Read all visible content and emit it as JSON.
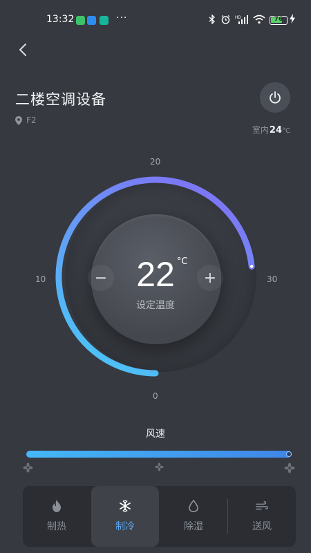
{
  "status": {
    "time": "13:32",
    "dots": "···",
    "battery": "76",
    "battery_level": 0.76
  },
  "header": {
    "title": "二楼空调设备",
    "location": "F2",
    "indoor_label": "室内",
    "indoor_value": "24",
    "indoor_unit": "°C"
  },
  "dial": {
    "tick_top": "20",
    "tick_left": "10",
    "tick_right": "30",
    "tick_bottom": "0",
    "temperature": "22",
    "unit": "°C",
    "label": "设定温度",
    "minus": "−",
    "plus": "+",
    "min": 0,
    "max": 30,
    "arc_colors": [
      "#45cdf7",
      "#7c78f5"
    ]
  },
  "wind": {
    "title": "风速",
    "level": 1.0
  },
  "modes": [
    {
      "label": "制热",
      "icon": "flame-icon",
      "active": false
    },
    {
      "label": "制冷",
      "icon": "snowflake-icon",
      "active": true
    },
    {
      "label": "除湿",
      "icon": "droplet-icon",
      "active": false
    },
    {
      "label": "送风",
      "icon": "wind-icon",
      "active": false
    }
  ],
  "colors": {
    "background": "#363940",
    "accent": "#5aa8f2",
    "mode_bar": "#2b2d33"
  }
}
